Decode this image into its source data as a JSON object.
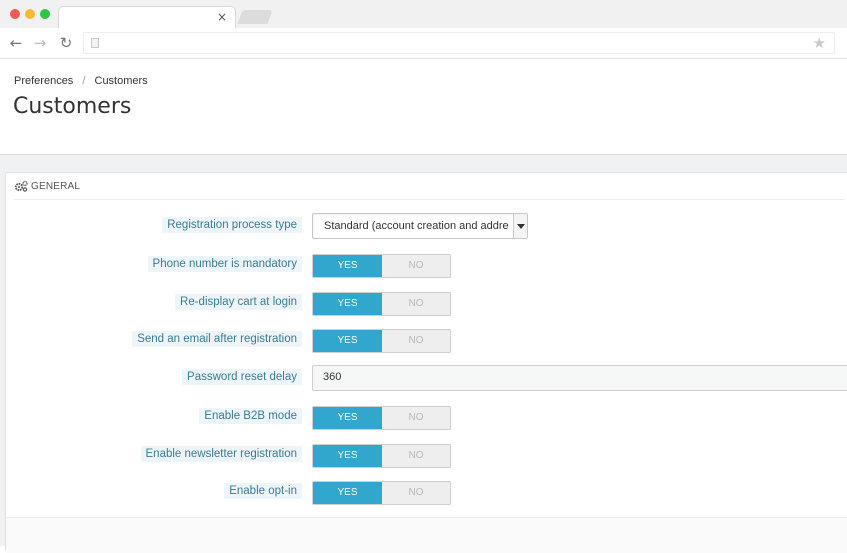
{
  "browser": {
    "tab_close": "×",
    "back": "←",
    "forward": "→",
    "reload": "↻",
    "star": "★"
  },
  "breadcrumb": {
    "parent": "Preferences",
    "separator": "/",
    "current": "Customers"
  },
  "page_title": "Customers",
  "panel": {
    "title": "GENERAL",
    "icon": "cogs-icon"
  },
  "fields": {
    "registration_type": {
      "label": "Registration process type",
      "value": "Standard (account creation and address creation)"
    },
    "phone_mandatory": {
      "label": "Phone number is mandatory",
      "yes": "YES",
      "no": "NO",
      "selected": "YES"
    },
    "redisplay_cart": {
      "label": "Re-display cart at login",
      "yes": "YES",
      "no": "NO",
      "selected": "YES"
    },
    "send_email": {
      "label": "Send an email after registration",
      "yes": "YES",
      "no": "NO",
      "selected": "YES"
    },
    "password_reset": {
      "label": "Password reset delay",
      "value": "360"
    },
    "b2b_mode": {
      "label": "Enable B2B mode",
      "yes": "YES",
      "no": "NO",
      "selected": "YES"
    },
    "newsletter": {
      "label": "Enable newsletter registration",
      "yes": "YES",
      "no": "NO",
      "selected": "YES"
    },
    "optin": {
      "label": "Enable opt-in",
      "yes": "YES",
      "no": "NO",
      "selected": "YES"
    }
  },
  "colors": {
    "accent": "#32a7cd",
    "label_text": "#3b7c93",
    "label_bg": "#edf5f8"
  }
}
